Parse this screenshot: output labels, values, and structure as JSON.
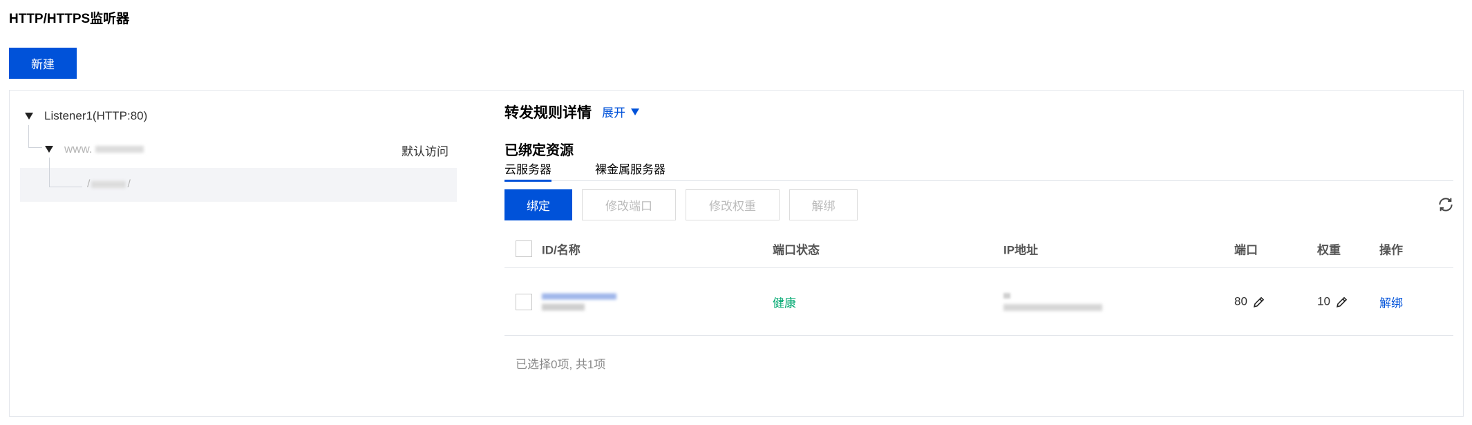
{
  "page": {
    "title": "HTTP/HTTPS监听器"
  },
  "toolbar": {
    "new_label": "新建"
  },
  "tree": {
    "listener_label": "Listener1(HTTP:80)",
    "domain_prefix": "www.",
    "path_prefix": "/",
    "path_suffix": "/",
    "default_access": "默认访问"
  },
  "detail": {
    "rule_title": "转发规则详情",
    "expand_label": "展开",
    "bound_title": "已绑定资源",
    "tabs": [
      {
        "label": "云服务器",
        "active": true
      },
      {
        "label": "裸金属服务器",
        "active": false
      }
    ],
    "actions": {
      "bind": "绑定",
      "modify_port": "修改端口",
      "modify_weight": "修改权重",
      "unbind": "解绑"
    }
  },
  "table": {
    "headers": [
      "ID/名称",
      "端口状态",
      "IP地址",
      "端口",
      "权重",
      "操作"
    ],
    "rows": [
      {
        "status": "健康",
        "port": "80",
        "weight": "10",
        "op": "解绑"
      }
    ],
    "footer": "已选择0项, 共1项"
  },
  "colors": {
    "primary": "#0052d9",
    "healthy": "#00a870"
  },
  "icons": {
    "refresh": "refresh-icon",
    "edit": "pencil-icon"
  }
}
